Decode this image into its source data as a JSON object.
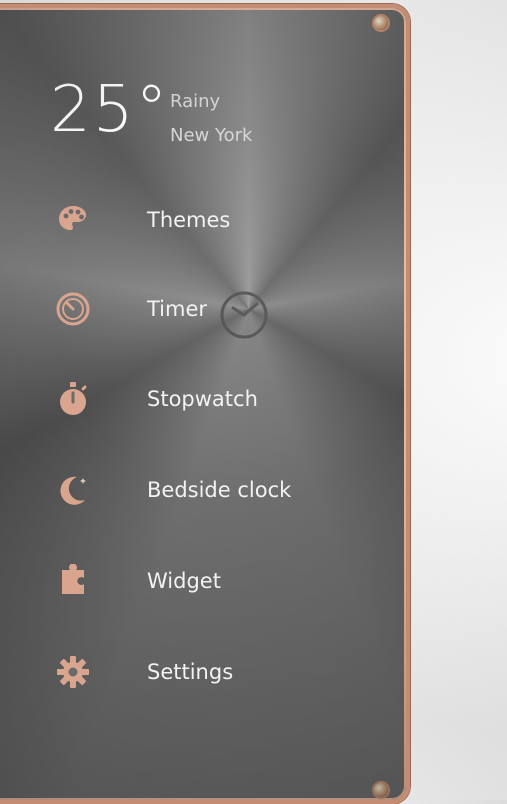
{
  "weather": {
    "temperature": "25°",
    "condition": "Rainy",
    "city": "New York"
  },
  "menu": [
    {
      "label": "Themes",
      "icon": "palette-icon"
    },
    {
      "label": "Timer",
      "icon": "timer-icon"
    },
    {
      "label": "Stopwatch",
      "icon": "stopwatch-icon"
    },
    {
      "label": "Bedside clock",
      "icon": "moon-icon"
    },
    {
      "label": "Widget",
      "icon": "puzzle-icon"
    },
    {
      "label": "Settings",
      "icon": "gear-icon"
    }
  ],
  "colors": {
    "accent": "#c48c73",
    "icon": "#d9a58f"
  }
}
